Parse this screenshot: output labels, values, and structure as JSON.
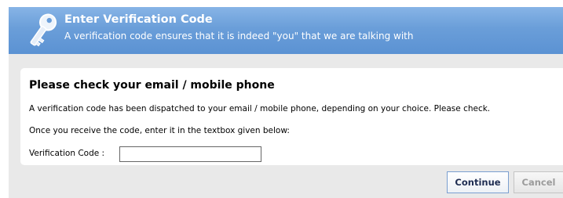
{
  "header": {
    "title": "Enter Verification Code",
    "subtitle": "A verification code ensures that it is indeed \"you\" that we are talking with",
    "icon": "key-icon"
  },
  "panel": {
    "heading": "Please check your email / mobile phone",
    "line1": "A verification code has been dispatched to your email / mobile phone, depending on your choice. Please check.",
    "line2": "Once you receive the code, enter it in the textbox given below:",
    "code_label": "Verification Code :",
    "code_value": "",
    "code_placeholder": ""
  },
  "buttons": {
    "continue_label": "Continue",
    "cancel_label": "Cancel"
  },
  "colors": {
    "header_gradient_top": "#87b4e6",
    "header_gradient_bottom": "#5b92d3",
    "dialog_background": "#e9e9e9",
    "continue_border": "#7a9fd0",
    "cancel_text": "#9b9b9b"
  }
}
